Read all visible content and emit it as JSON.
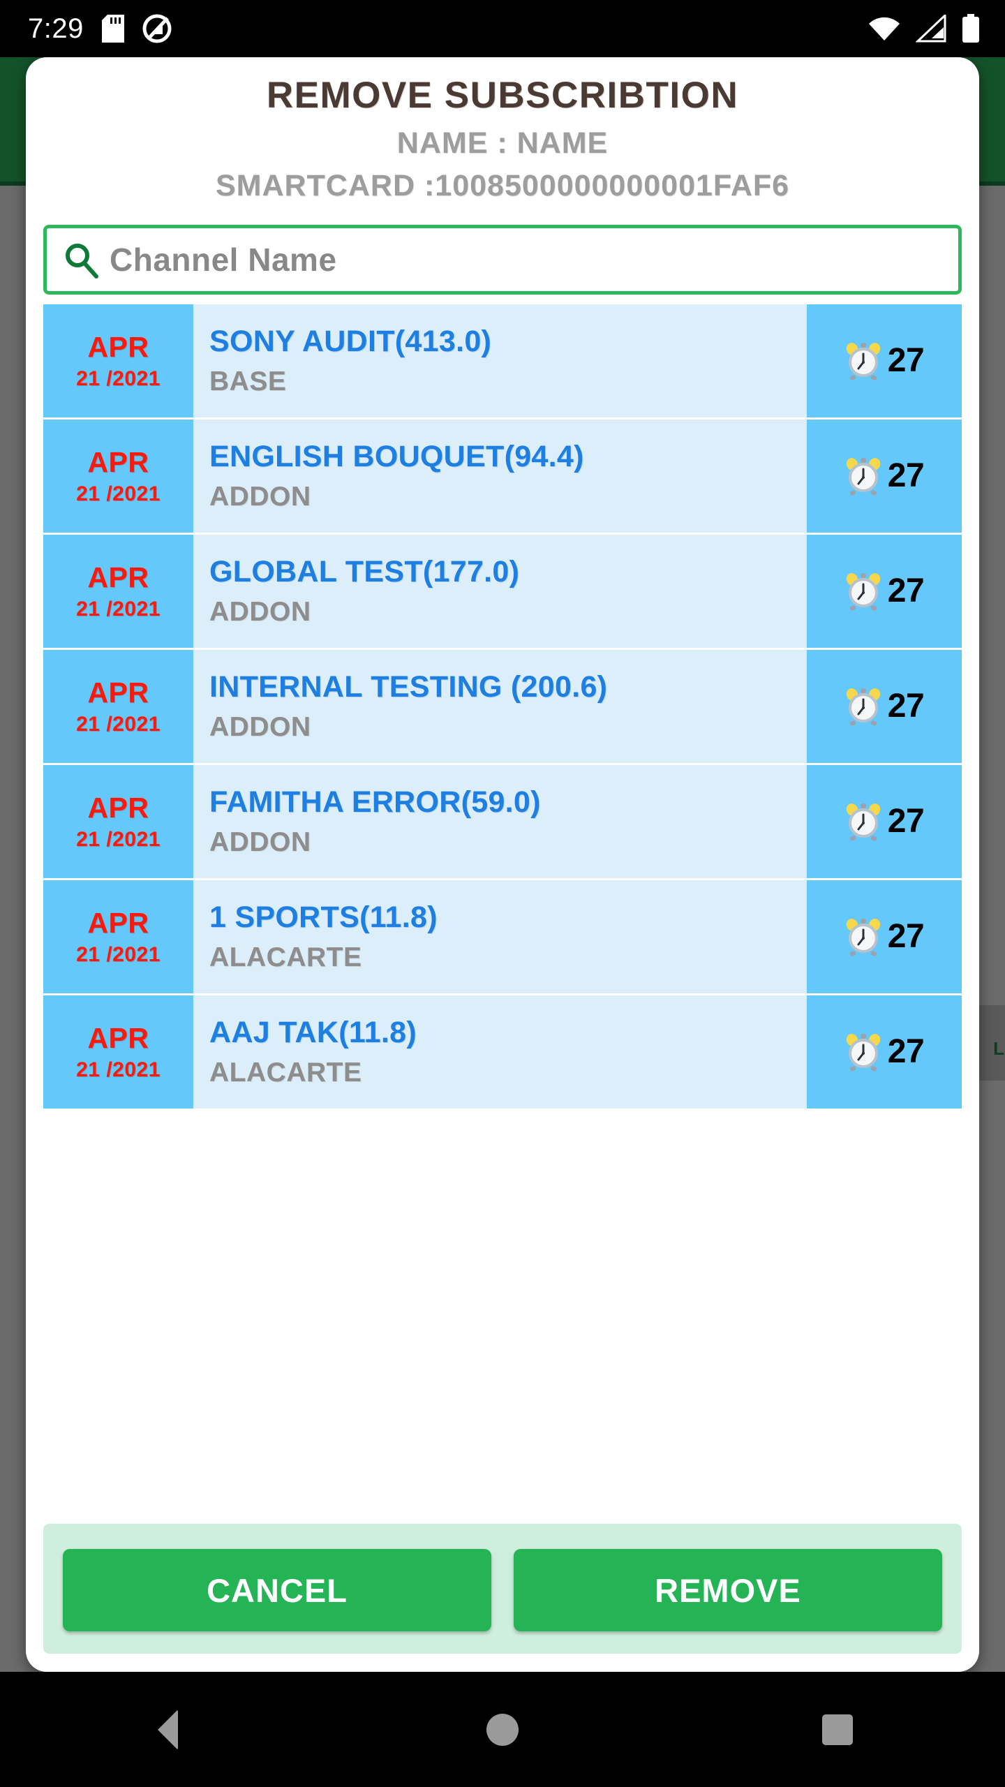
{
  "status_bar": {
    "clock": "7:29",
    "icons": [
      "sd-card-icon",
      "do-not-disturb-icon",
      "wifi-icon",
      "cellular-signal-icon",
      "battery-icon"
    ]
  },
  "dialog": {
    "title": "REMOVE SUBSCRIBTION",
    "name_line": "NAME : NAME",
    "smartcard_line": "SMARTCARD :1008500000000001FAF6"
  },
  "search": {
    "placeholder": "Channel Name",
    "value": "",
    "icon": "search-icon"
  },
  "list": {
    "rows": [
      {
        "month": "APR",
        "day": "21 /2021",
        "channel": "SONY AUDIT(413.0)",
        "type": "BASE",
        "days": "27",
        "icon": "alarm-clock-icon"
      },
      {
        "month": "APR",
        "day": "21 /2021",
        "channel": "ENGLISH BOUQUET(94.4)",
        "type": "ADDON",
        "days": "27",
        "icon": "alarm-clock-icon"
      },
      {
        "month": "APR",
        "day": "21 /2021",
        "channel": "GLOBAL TEST(177.0)",
        "type": "ADDON",
        "days": "27",
        "icon": "alarm-clock-icon"
      },
      {
        "month": "APR",
        "day": "21 /2021",
        "channel": "INTERNAL TESTING (200.6)",
        "type": "ADDON",
        "days": "27",
        "icon": "alarm-clock-icon"
      },
      {
        "month": "APR",
        "day": "21 /2021",
        "channel": "FAMITHA ERROR(59.0)",
        "type": "ADDON",
        "days": "27",
        "icon": "alarm-clock-icon"
      },
      {
        "month": "APR",
        "day": "21 /2021",
        "channel": "1 SPORTS(11.8)",
        "type": "ALACARTE",
        "days": "27",
        "icon": "alarm-clock-icon"
      },
      {
        "month": "APR",
        "day": "21 /2021",
        "channel": "AAJ TAK(11.8)",
        "type": "ALACARTE",
        "days": "27",
        "icon": "alarm-clock-icon"
      }
    ]
  },
  "footer": {
    "cancel_label": "CANCEL",
    "remove_label": "REMOVE"
  },
  "background": {
    "side_button_label": "L"
  },
  "nav_bar": {
    "back": "back-icon",
    "home": "home-icon",
    "recents": "recents-icon"
  },
  "colors": {
    "accent_green": "#24b355",
    "search_border": "#2eb85c",
    "row_side_blue": "#64c8fa",
    "row_body_blue": "#dceefa",
    "channel_blue": "#1f7fe0",
    "date_red": "#f81a0c",
    "type_gray": "#8d8d8d",
    "title_brown": "#4a3a33",
    "subtitle_gray": "#9d9d9d",
    "footer_bg": "#cfeedb",
    "appbar_green": "#14532a"
  }
}
